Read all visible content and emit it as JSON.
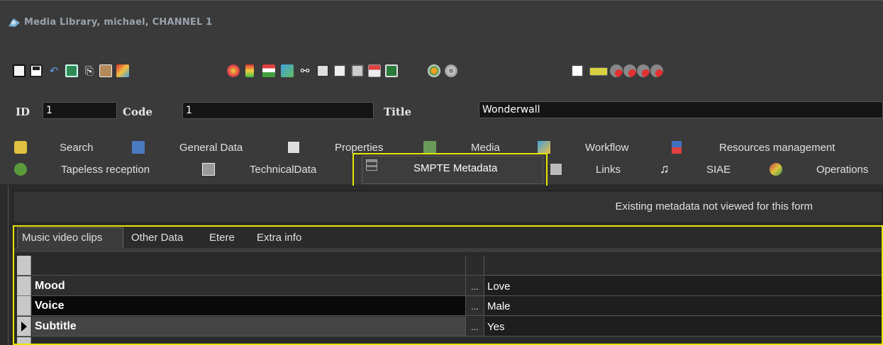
{
  "window": {
    "title": "Media Library, michael, CHANNEL 1"
  },
  "toolbar": {
    "icons": [
      "new-icon",
      "save-icon",
      "undo-icon",
      "refresh-icon",
      "copy-icon",
      "paste-icon",
      "edit-icon",
      "color-icon",
      "bars-icon",
      "filter-icon",
      "layers-icon",
      "binoculars-icon",
      "list-icon",
      "preview-icon",
      "doc-icon",
      "window-icon",
      "monitor-icon",
      "play-icon",
      "disc-icon",
      "x-icon",
      "card-icon",
      "user-icon"
    ]
  },
  "record": {
    "id_label": "ID",
    "id_value": "1",
    "code_label": "Code",
    "code_value": "1",
    "title_label": "Title",
    "title_value": "Wonderwall"
  },
  "tabs": {
    "row1": [
      "Search",
      "General Data",
      "Properties",
      "Media",
      "Workflow",
      "Resources management"
    ],
    "row2": [
      "Tapeless reception",
      "TechnicalData",
      "SMPTE Metadata",
      "Links",
      "SIAE",
      "Operations"
    ]
  },
  "panel": {
    "message": "Existing metadata not viewed for this form"
  },
  "subtabs": [
    "Music video clips",
    "Other Data",
    "Etere",
    "Extra info"
  ],
  "grid": {
    "rows": [
      {
        "name": "Mood",
        "dots": "...",
        "value": "Love"
      },
      {
        "name": "Voice",
        "dots": "...",
        "value": "Male"
      },
      {
        "name": "Subtitle",
        "dots": "...",
        "value": "Yes"
      }
    ]
  },
  "colors": {
    "highlight": "#e6e600",
    "background": "#2b2b2b",
    "toolbar": "#3a3a3a"
  }
}
